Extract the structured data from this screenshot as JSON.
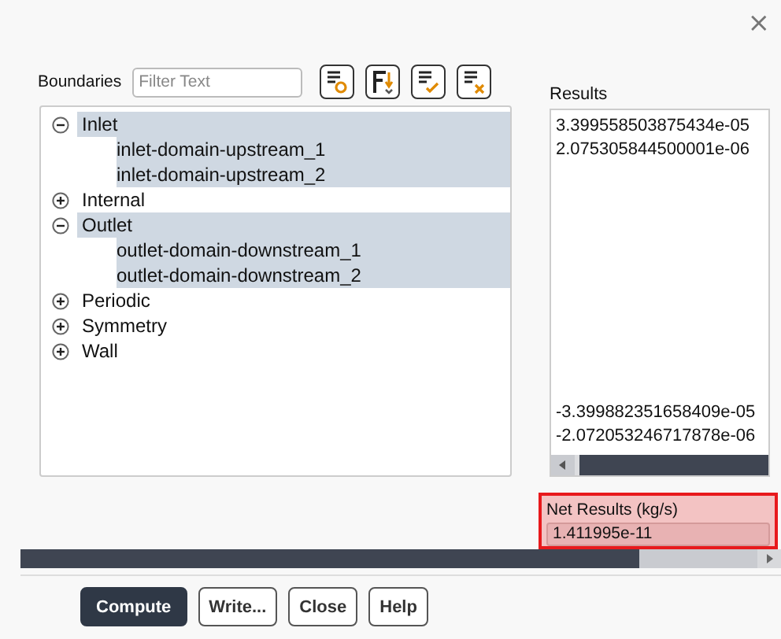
{
  "close_button": "×",
  "boundaries": {
    "label": "Boundaries",
    "filter": {
      "placeholder": "Filter Text"
    },
    "tree": [
      {
        "label": "Inlet",
        "expanded": true,
        "selected": true,
        "children": [
          {
            "label": "inlet-domain-upstream_1",
            "selected": true
          },
          {
            "label": "inlet-domain-upstream_2",
            "selected": true
          }
        ]
      },
      {
        "label": "Internal",
        "expanded": false,
        "selected": false
      },
      {
        "label": "Outlet",
        "expanded": true,
        "selected": true,
        "children": [
          {
            "label": "outlet-domain-downstream_1",
            "selected": true
          },
          {
            "label": "outlet-domain-downstream_2",
            "selected": true
          }
        ]
      },
      {
        "label": "Periodic",
        "expanded": false,
        "selected": false
      },
      {
        "label": "Symmetry",
        "expanded": false,
        "selected": false
      },
      {
        "label": "Wall",
        "expanded": false,
        "selected": false
      }
    ]
  },
  "results": {
    "label": "Results",
    "top": [
      "3.399558503875434e-05",
      "2.075305844500001e-06"
    ],
    "bottom": [
      "-3.399882351658409e-05",
      "-2.072053246717878e-06"
    ]
  },
  "net_results": {
    "label": "Net Results (kg/s)",
    "value": "1.411995e-11"
  },
  "buttons": [
    {
      "label": "Compute",
      "primary": true
    },
    {
      "label": "Write...",
      "primary": false
    },
    {
      "label": "Close",
      "primary": false
    },
    {
      "label": "Help",
      "primary": false
    }
  ]
}
